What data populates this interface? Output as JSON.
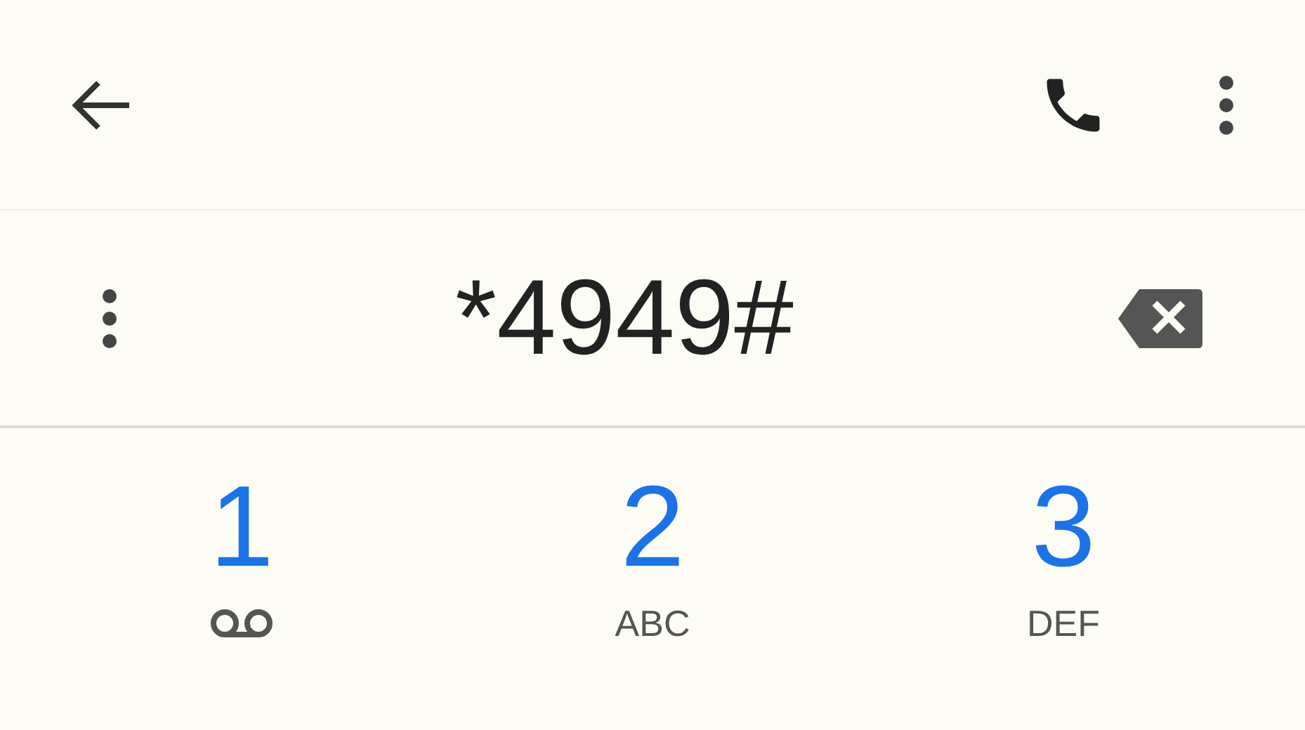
{
  "number": "*4949#",
  "keys": [
    {
      "digit": "1",
      "kind": "voicemail"
    },
    {
      "digit": "2",
      "kind": "letters",
      "letters": "ABC"
    },
    {
      "digit": "3",
      "kind": "letters",
      "letters": "DEF"
    }
  ]
}
